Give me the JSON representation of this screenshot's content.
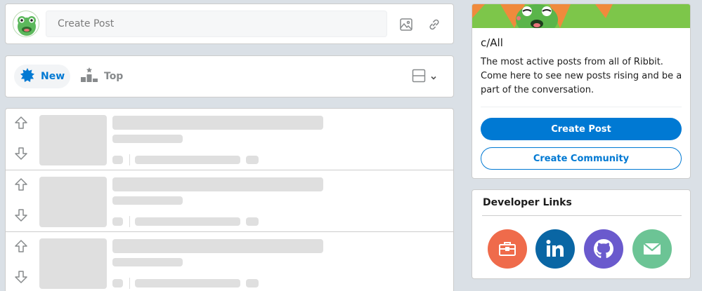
{
  "create_post_bar": {
    "placeholder": "Create Post",
    "image_icon": "image-icon",
    "link_icon": "link-icon"
  },
  "sort_bar": {
    "tabs": [
      {
        "label": "New",
        "icon": "sparkle-icon",
        "active": true
      },
      {
        "label": "Top",
        "icon": "podium-icon",
        "active": false
      }
    ],
    "layout_icon": "card-layout-icon"
  },
  "community": {
    "title": "c/All",
    "description": "The most active posts from all of Ribbit. Come here to see new posts rising and be a part of the conversation.",
    "create_post_label": "Create Post",
    "create_community_label": "Create Community"
  },
  "developer_links": {
    "title": "Developer Links",
    "links": [
      {
        "name": "portfolio-icon",
        "color": "#ef6b4b"
      },
      {
        "name": "linkedin-icon",
        "color": "#0a66a4"
      },
      {
        "name": "github-icon",
        "color": "#6a5acd"
      },
      {
        "name": "email-icon",
        "color": "#6cc495"
      }
    ]
  },
  "colors": {
    "accent": "#0079d3",
    "skeleton": "#dfdfdf",
    "background": "#dae0e6"
  }
}
